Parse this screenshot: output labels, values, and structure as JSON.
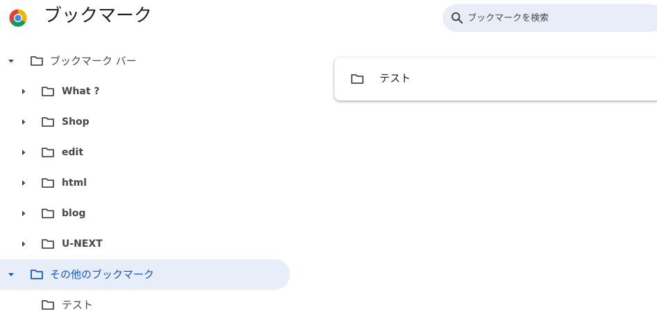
{
  "header": {
    "title": "ブックマーク",
    "logo_icon": "chrome-logo-icon"
  },
  "search": {
    "placeholder": "ブックマークを検索",
    "value": "",
    "icon": "search-icon"
  },
  "sidebar": {
    "items": [
      {
        "label": "ブックマーク バー",
        "level": 0,
        "expanded": true,
        "icon": "folder-icon"
      },
      {
        "label": "What ?",
        "level": 1,
        "expanded": false,
        "icon": "folder-icon"
      },
      {
        "label": "Shop",
        "level": 1,
        "expanded": false,
        "icon": "folder-icon"
      },
      {
        "label": "edit",
        "level": 1,
        "expanded": false,
        "icon": "folder-icon"
      },
      {
        "label": "html",
        "level": 1,
        "expanded": false,
        "icon": "folder-icon"
      },
      {
        "label": "blog",
        "level": 1,
        "expanded": false,
        "icon": "folder-icon"
      },
      {
        "label": "U-NEXT",
        "level": 1,
        "expanded": false,
        "icon": "folder-icon"
      },
      {
        "label": "その他のブックマーク",
        "level": 0,
        "expanded": true,
        "selected": true,
        "icon": "folder-icon"
      },
      {
        "label": "テスト",
        "level": 1,
        "expanded": false,
        "icon": "folder-icon"
      }
    ]
  },
  "main": {
    "items": [
      {
        "label": "テスト",
        "icon": "folder-icon"
      }
    ]
  },
  "colors": {
    "accent": "#0b57d0",
    "selected_background": "#e8eef9",
    "search_background": "#e8edf7",
    "icon": "#474747"
  }
}
